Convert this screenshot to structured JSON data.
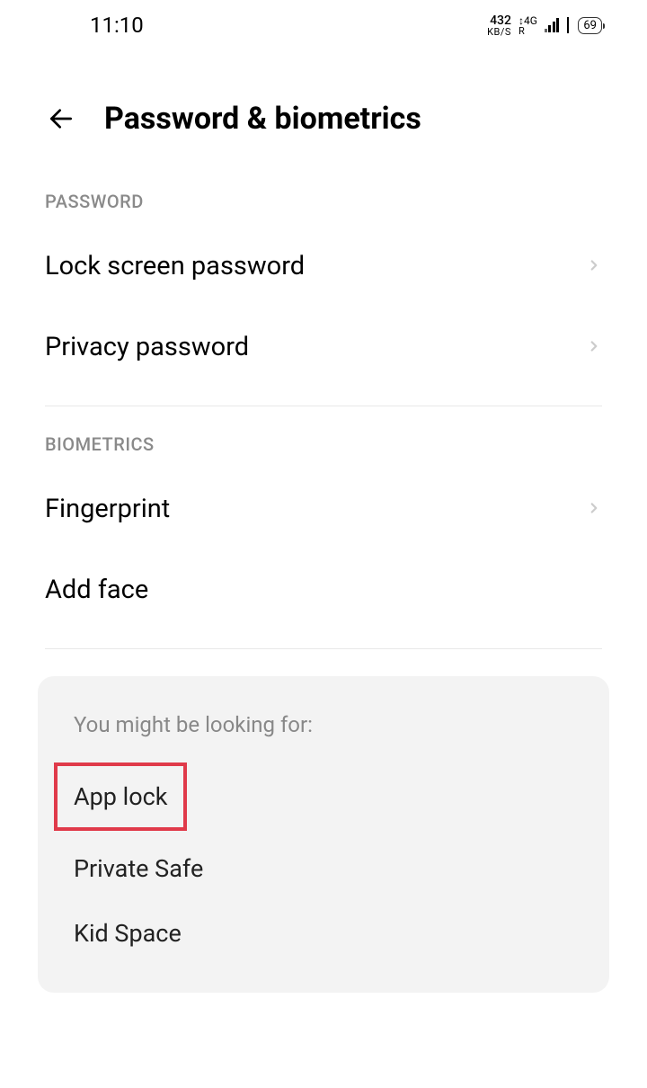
{
  "statusBar": {
    "time": "11:10",
    "speedValue": "432",
    "speedUnit": "KB/S",
    "networkType": "4G",
    "networkR": "R",
    "battery": "69"
  },
  "header": {
    "title": "Password & biometrics"
  },
  "sections": {
    "password": {
      "label": "PASSWORD",
      "items": {
        "lockScreen": "Lock screen password",
        "privacy": "Privacy password"
      }
    },
    "biometrics": {
      "label": "BIOMETRICS",
      "items": {
        "fingerprint": "Fingerprint",
        "addFace": "Add face"
      }
    }
  },
  "suggestions": {
    "title": "You might be looking for:",
    "items": {
      "appLock": "App lock",
      "privateSafe": "Private Safe",
      "kidSpace": "Kid Space"
    }
  }
}
